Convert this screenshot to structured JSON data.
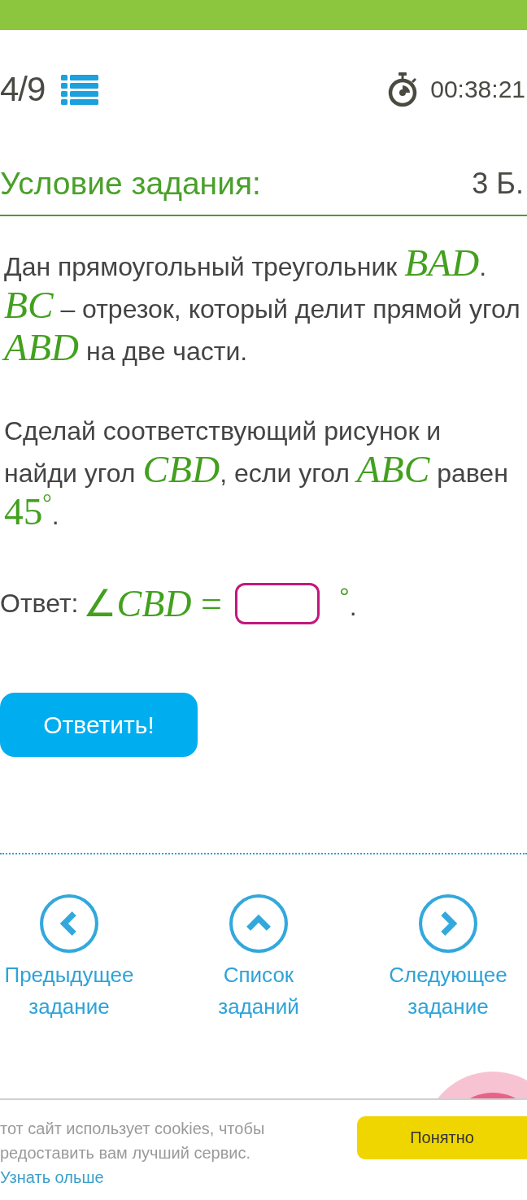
{
  "header": {
    "progress": "4/9",
    "timer": "00:38:21"
  },
  "task": {
    "title": "Условие задания:",
    "points": "3 Б.",
    "paragraphs": [
      [
        {
          "kind": "text",
          "text": "Дан прямоугольный треугольник "
        },
        {
          "kind": "math",
          "text": "BAD"
        },
        {
          "kind": "text",
          "text": ". "
        },
        {
          "kind": "math",
          "text": "BC"
        },
        {
          "kind": "text",
          "text": " – отрезок, который делит прямой угол "
        },
        {
          "kind": "math",
          "text": "ABD"
        },
        {
          "kind": "text",
          "text": " на две части."
        }
      ],
      [
        {
          "kind": "text",
          "text": "Сделай соответствующий рисунок и\nнайди угол "
        },
        {
          "kind": "math",
          "text": "CBD"
        },
        {
          "kind": "text",
          "text": ", если угол "
        },
        {
          "kind": "math",
          "text": "ABC"
        },
        {
          "kind": "text",
          "text": " равен "
        },
        {
          "kind": "number",
          "text": "45$^{°}$"
        },
        {
          "kind": "text",
          "text": "."
        }
      ]
    ]
  },
  "answer": {
    "label": "Ответ:",
    "expression": "∠*CBD* =",
    "unit": "$^{°}$."
  },
  "submit_button": "Ответить!",
  "navigation": [
    {
      "kind": "previous",
      "label": "Предыдущее задание"
    },
    {
      "kind": "list",
      "label": "Список заданий"
    },
    {
      "kind": "next",
      "label": "Следующее задание"
    }
  ],
  "cookie_notice": {
    "text": "тот сайт использует cookies, чтобы редоставить вам лучший сервис.",
    "link": "Узнать ольше",
    "button": "Понятно"
  }
}
